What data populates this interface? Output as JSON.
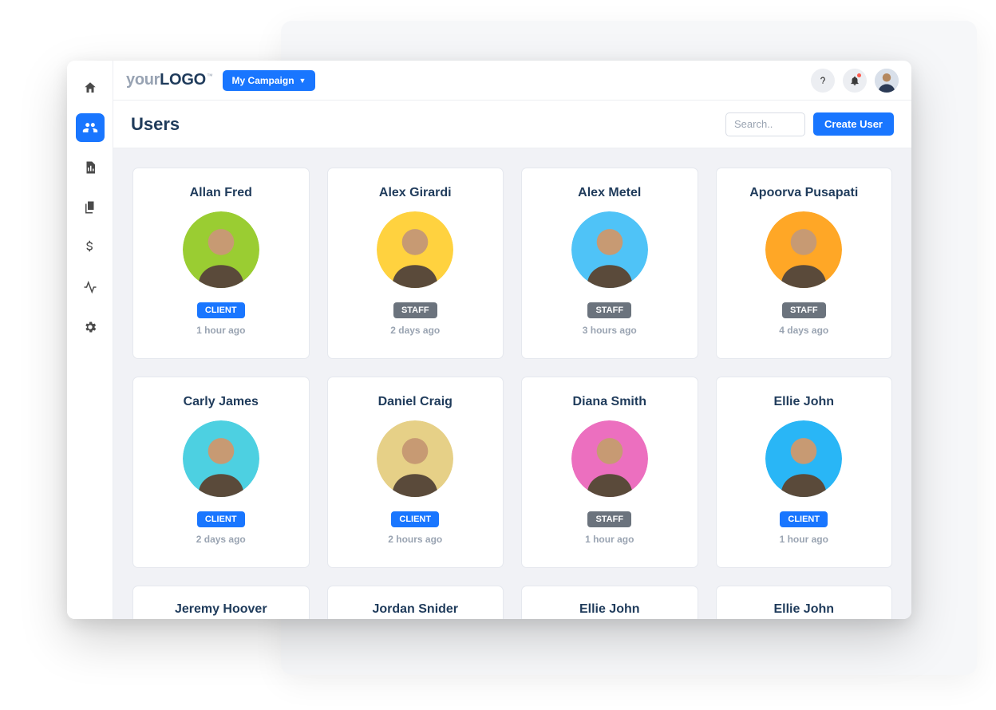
{
  "logo": {
    "part1": "your",
    "part2": "LOGO",
    "tm": "™"
  },
  "campaign_label": "My Campaign",
  "page_title": "Users",
  "search_placeholder": "Search..",
  "create_user_label": "Create User",
  "sidebar": [
    {
      "name": "home",
      "active": false
    },
    {
      "name": "users",
      "active": true
    },
    {
      "name": "reports",
      "active": false
    },
    {
      "name": "documents",
      "active": false
    },
    {
      "name": "billing",
      "active": false
    },
    {
      "name": "activity",
      "active": false
    },
    {
      "name": "settings",
      "active": false
    }
  ],
  "users": [
    {
      "name": "Allan Fred",
      "role": "CLIENT",
      "time": "1 hour ago",
      "avatar_bg": "#9ACD32"
    },
    {
      "name": "Alex Girardi",
      "role": "STAFF",
      "time": "2 days ago",
      "avatar_bg": "#FFD23F"
    },
    {
      "name": "Alex Metel",
      "role": "STAFF",
      "time": "3 hours ago",
      "avatar_bg": "#4FC3F7"
    },
    {
      "name": "Apoorva Pusapati",
      "role": "STAFF",
      "time": "4 days ago",
      "avatar_bg": "#FFA726"
    },
    {
      "name": "Carly James",
      "role": "CLIENT",
      "time": "2 days ago",
      "avatar_bg": "#4DD0E1"
    },
    {
      "name": "Daniel Craig",
      "role": "CLIENT",
      "time": "2 hours ago",
      "avatar_bg": "#E6D087"
    },
    {
      "name": "Diana Smith",
      "role": "STAFF",
      "time": "1 hour ago",
      "avatar_bg": "#EC6FBF"
    },
    {
      "name": "Ellie John",
      "role": "CLIENT",
      "time": "1 hour ago",
      "avatar_bg": "#29B6F6"
    },
    {
      "name": "Jeremy Hoover"
    },
    {
      "name": "Jordan Snider"
    },
    {
      "name": "Ellie John"
    },
    {
      "name": "Ellie John"
    }
  ]
}
